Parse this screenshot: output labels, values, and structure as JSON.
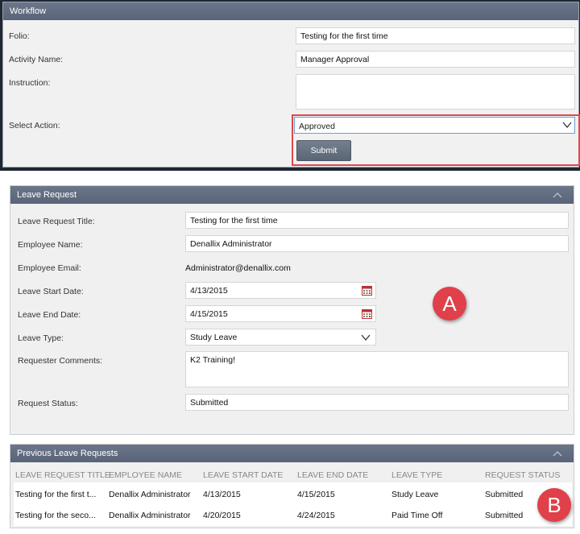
{
  "workflow": {
    "title": "Workflow",
    "folio_label": "Folio:",
    "folio_value": "Testing for the first time",
    "activity_label": "Activity Name:",
    "activity_value": "Manager Approval",
    "instruction_label": "Instruction:",
    "instruction_value": "",
    "action_label": "Select Action:",
    "action_value": "Approved",
    "submit_label": "Submit"
  },
  "leave_request": {
    "title": "Leave Request",
    "fields": {
      "title_label": "Leave Request Title:",
      "title_value": "Testing for the first time",
      "name_label": "Employee Name:",
      "name_value": "Denallix Administrator",
      "email_label": "Employee Email:",
      "email_value": "Administrator@denallix.com",
      "start_label": "Leave Start Date:",
      "start_value": "4/13/2015",
      "end_label": "Leave End Date:",
      "end_value": "4/15/2015",
      "type_label": "Leave Type:",
      "type_value": "Study Leave",
      "comments_label": "Requester Comments:",
      "comments_value": "K2 Training!",
      "status_label": "Request Status:",
      "status_value": "Submitted"
    }
  },
  "previous": {
    "title": "Previous Leave Requests",
    "columns": [
      "LEAVE REQUEST TITLE",
      "EMPLOYEE NAME",
      "LEAVE START DATE",
      "LEAVE END DATE",
      "LEAVE TYPE",
      "REQUEST STATUS"
    ],
    "rows": [
      [
        "Testing for the first t...",
        "Denallix Administrator",
        "4/13/2015",
        "4/15/2015",
        "Study Leave",
        "Submitted"
      ],
      [
        "Testing for the seco...",
        "Denallix Administrator",
        "4/20/2015",
        "4/24/2015",
        "Paid Time Off",
        "Submitted"
      ]
    ]
  },
  "annotations": {
    "a": "A",
    "b": "B"
  },
  "colors": {
    "header": "#5f6a7e",
    "highlight": "#e0474b",
    "badge": "#e0404a"
  }
}
